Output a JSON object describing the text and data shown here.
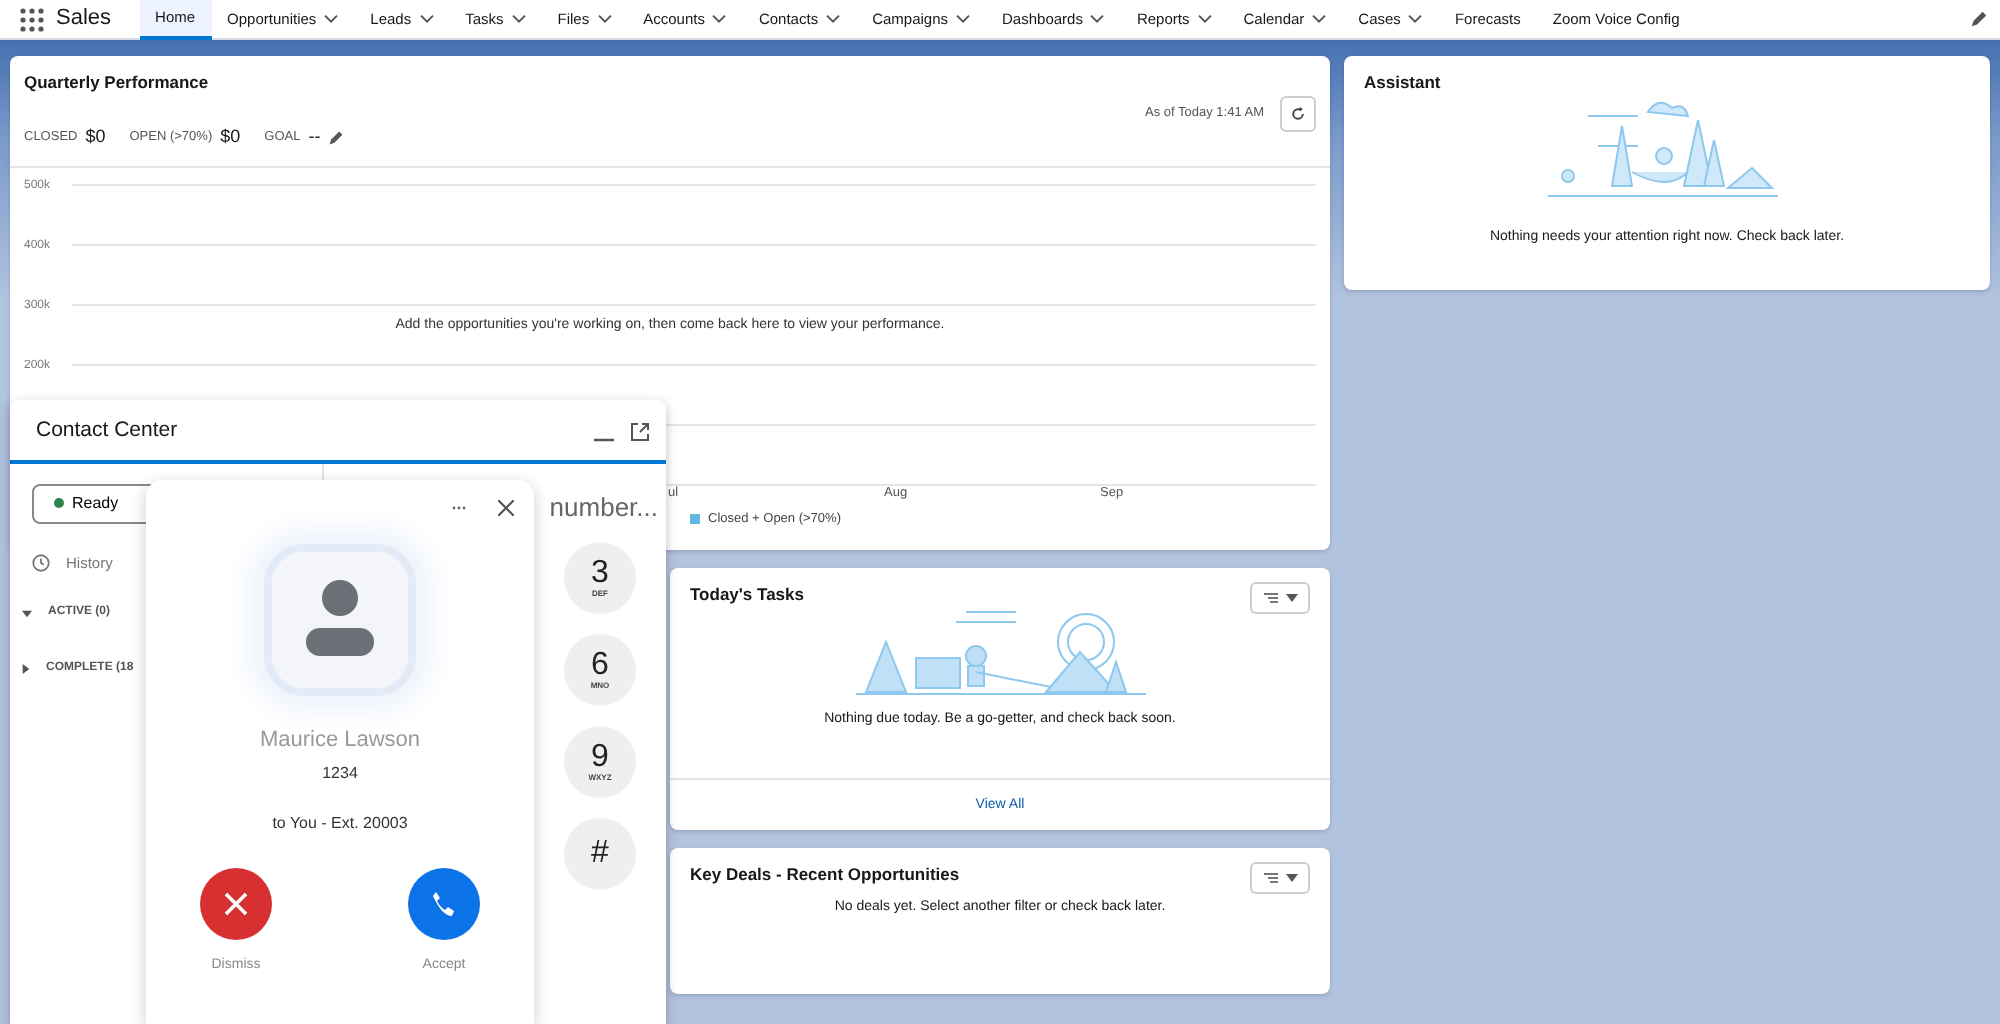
{
  "app": {
    "name": "Sales"
  },
  "nav": [
    {
      "label": "Home",
      "selected": true,
      "has_menu": false
    },
    {
      "label": "Opportunities",
      "selected": false,
      "has_menu": true
    },
    {
      "label": "Leads",
      "selected": false,
      "has_menu": true
    },
    {
      "label": "Tasks",
      "selected": false,
      "has_menu": true
    },
    {
      "label": "Files",
      "selected": false,
      "has_menu": true
    },
    {
      "label": "Accounts",
      "selected": false,
      "has_menu": true
    },
    {
      "label": "Contacts",
      "selected": false,
      "has_menu": true
    },
    {
      "label": "Campaigns",
      "selected": false,
      "has_menu": true
    },
    {
      "label": "Dashboards",
      "selected": false,
      "has_menu": true
    },
    {
      "label": "Reports",
      "selected": false,
      "has_menu": true
    },
    {
      "label": "Calendar",
      "selected": false,
      "has_menu": true
    },
    {
      "label": "Cases",
      "selected": false,
      "has_menu": true
    },
    {
      "label": "Forecasts",
      "selected": false,
      "has_menu": false
    },
    {
      "label": "Zoom Voice Config",
      "selected": false,
      "has_menu": false
    }
  ],
  "quarterly_performance": {
    "title": "Quarterly Performance",
    "as_of": "As of Today 1:41 AM",
    "stats": [
      {
        "label": "CLOSED",
        "value": "$0"
      },
      {
        "label": "OPEN (>70%)",
        "value": "$0"
      },
      {
        "label": "GOAL",
        "value": "--"
      }
    ],
    "y_axis_labels": [
      "500k",
      "400k",
      "300k",
      "200k"
    ],
    "x_axis_labels": [
      "ul",
      "Aug",
      "Sep"
    ],
    "empty_message": "Add the opportunities you're working on, then come back here to view your performance.",
    "legend": "Closed + Open (>70%)"
  },
  "assistant": {
    "title": "Assistant",
    "message": "Nothing needs your attention right now. Check back later."
  },
  "todays_tasks": {
    "title": "Today's Tasks",
    "message": "Nothing due today. Be a go-getter, and check back soon.",
    "link": "View All"
  },
  "key_deals": {
    "title": "Key Deals - Recent Opportunities",
    "message": "No deals yet. Select another filter or check back later."
  },
  "contact_center": {
    "title": "Contact Center",
    "status": "Ready",
    "history": "History",
    "groups": [
      {
        "label": "ACTIVE (0)",
        "expanded": true
      },
      {
        "label": "COMPLETE (18",
        "expanded": false
      }
    ],
    "dial_text": "number...",
    "keys": [
      {
        "digit": "3",
        "letters": "DEF"
      },
      {
        "digit": "6",
        "letters": "MNO"
      },
      {
        "digit": "9",
        "letters": "WXYZ"
      },
      {
        "digit": "#"
      }
    ]
  },
  "incoming_call": {
    "caller": "Maurice Lawson",
    "number": "1234",
    "target": "to You - Ext. 20003",
    "actions": [
      {
        "kind": "dismiss",
        "label": "Dismiss"
      },
      {
        "kind": "accept",
        "label": "Accept"
      }
    ]
  }
}
